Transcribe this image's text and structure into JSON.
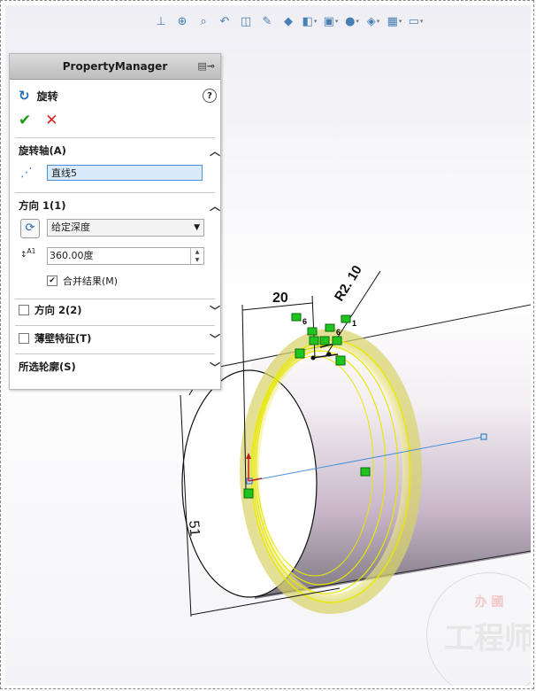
{
  "toolbar": {
    "icons": [
      "view-orientation-icon",
      "zoom-fit-icon",
      "zoom-area-icon",
      "previous-view-icon",
      "section-view-icon",
      "dynamic-annotation-icon",
      "view-cube-icon",
      "display-style-icon",
      "hide-show-icon",
      "edit-appearance-icon",
      "apply-scene-icon",
      "view-settings-icon",
      "monitor-icon"
    ]
  },
  "property_manager": {
    "title": "PropertyManager",
    "feature_name": "旋转",
    "help": "?",
    "ok": "✔",
    "cancel": "✕",
    "axis_section": {
      "label": "旋转轴(A)",
      "value": "直线5"
    },
    "dir1_section": {
      "label": "方向 1(1)",
      "end_condition": "给定深度",
      "angle": "360.00度",
      "merge_label": "合并结果(M)",
      "merge_checked": true
    },
    "dir2_section": {
      "label": "方向 2(2)",
      "checked": false
    },
    "thin_section": {
      "label": "薄壁特征(T)",
      "checked": false
    },
    "contours_section": {
      "label": "所选轮廓(S)"
    }
  },
  "sketch": {
    "dim_width": "20",
    "dim_radius": "R2. 10",
    "dim_diameter": "51",
    "relations": [
      "6",
      "6",
      "1"
    ]
  },
  "watermark": {
    "top": "办 國",
    "main": "工程师"
  },
  "colors": {
    "sketch_line": "#e8e800",
    "relation_green": "#1fc41f",
    "axis_line": "#4a90d9",
    "selection_blue": "#4a90d9"
  }
}
